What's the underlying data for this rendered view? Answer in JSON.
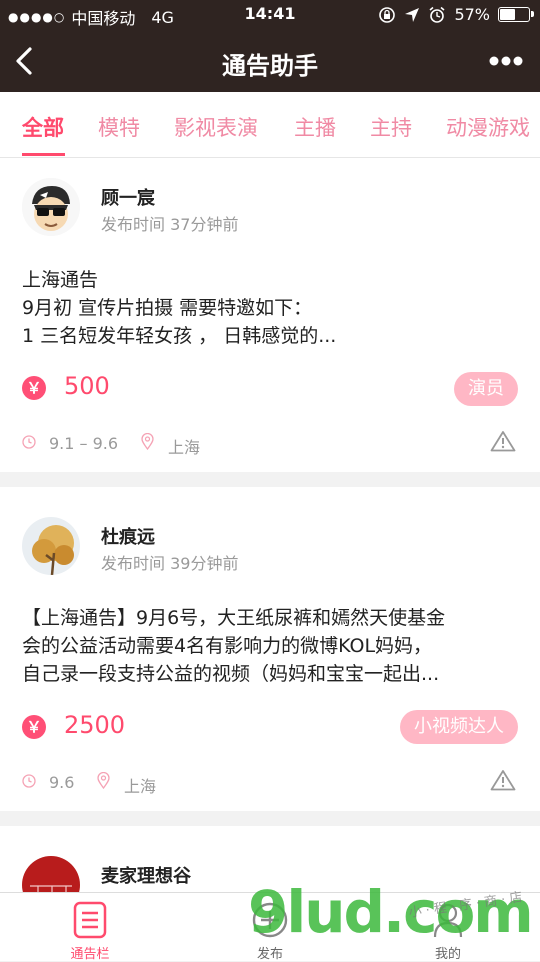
{
  "status_bar": {
    "carrier": "中国移动",
    "network": "4G",
    "time": "14:41",
    "battery": "57%",
    "battery_level": 0.57
  },
  "nav": {
    "title": "通告助手"
  },
  "tabs": [
    {
      "label": "全部",
      "active": true
    },
    {
      "label": "模特",
      "active": false
    },
    {
      "label": "影视表演",
      "active": false
    },
    {
      "label": "主播",
      "active": false
    },
    {
      "label": "主持",
      "active": false
    },
    {
      "label": "动漫游戏",
      "active": false
    }
  ],
  "posts": [
    {
      "user": "顾一宸",
      "time": "发布时间 37分钟前",
      "lines": [
        "上海通告",
        "9月初 宣传片拍摄 需要特邀如下：",
        "1 三名短发年轻女孩 ， 日韩感觉的..."
      ],
      "price_icon": "￥",
      "price": "500",
      "tag": "演员",
      "date": "9.1 – 9.6",
      "location": "上海"
    },
    {
      "user": "杜痕远",
      "time": "发布时间 39分钟前",
      "lines": [
        "【上海通告】9月6号，大王纸尿裤和嫣然天使基金",
        "会的公益活动需要4名有影响力的微博KOL妈妈，",
        "自己录一段支持公益的视频（妈妈和宝宝一起出..."
      ],
      "price_icon": "￥",
      "price": "2500",
      "tag": "小视频达人",
      "date": "9.6",
      "location": "上海"
    },
    {
      "user": "麦家理想谷"
    }
  ],
  "tabbar": {
    "notices": "通告栏",
    "publish": "发布",
    "mine": "我的"
  },
  "watermark": {
    "text": "9lud.com",
    "small": "小 · 程 · 序 · 商 · 店"
  },
  "colors": {
    "accent": "#ff4a6d",
    "nav_bg": "#2f2421",
    "tag_bg": "#ffb7c5"
  }
}
